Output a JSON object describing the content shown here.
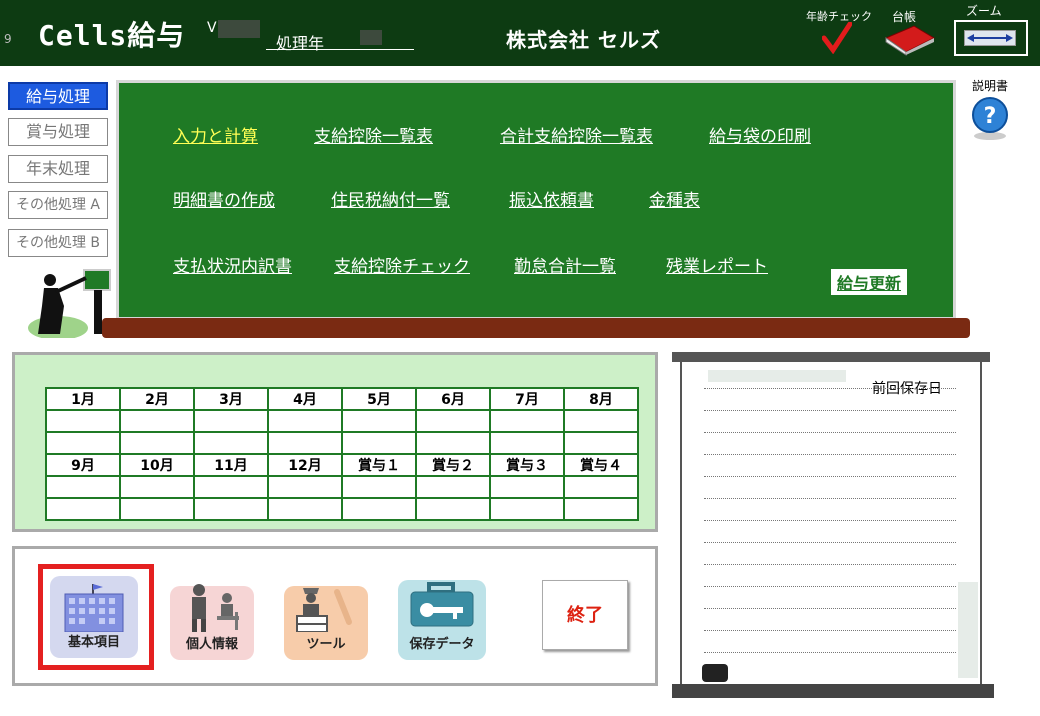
{
  "header": {
    "num": "9",
    "app_title": "Cells給与",
    "version_prefix": "V",
    "year_label": "処理年",
    "company": "株式会社 セルズ",
    "age_check_label": "年齢チェック",
    "ledger_label": "台帳",
    "zoom_label": "ズーム"
  },
  "sidebar": {
    "items": [
      {
        "label": "給与処理",
        "active": true
      },
      {
        "label": "賞与処理",
        "active": false
      },
      {
        "label": "年末処理",
        "active": false
      },
      {
        "label": "その他処理 A",
        "active": false
      },
      {
        "label": "その他処理 B",
        "active": false
      }
    ]
  },
  "help": {
    "label": "説明書"
  },
  "board": {
    "row1": [
      "入力と計算",
      "支給控除一覧表",
      "合計支給控除一覧表",
      "給与袋の印刷"
    ],
    "row2": [
      "明細書の作成",
      "住民税納付一覧",
      "振込依頼書",
      "金種表"
    ],
    "row3": [
      "支払状況内訳書",
      "支給控除チェック",
      "勤怠合計一覧",
      "残業レポート"
    ],
    "update_button": "給与更新"
  },
  "calendar": {
    "row1": [
      "1月",
      "2月",
      "3月",
      "4月",
      "5月",
      "6月",
      "7月",
      "8月"
    ],
    "row2": [
      "9月",
      "10月",
      "11月",
      "12月",
      "賞与１",
      "賞与２",
      "賞与３",
      "賞与４"
    ]
  },
  "tools": {
    "basic": "基本項目",
    "personal": "個人情報",
    "tool": "ツール",
    "save_data": "保存データ",
    "exit": "終了"
  },
  "notebook": {
    "last_saved_label": "前回保存日"
  },
  "colors": {
    "header_bg": "#0d3b12",
    "board_green": "#1f7a25",
    "highlight_link": "#ffff55",
    "active_tab": "#1d5be0",
    "exit_red": "#d21111"
  }
}
